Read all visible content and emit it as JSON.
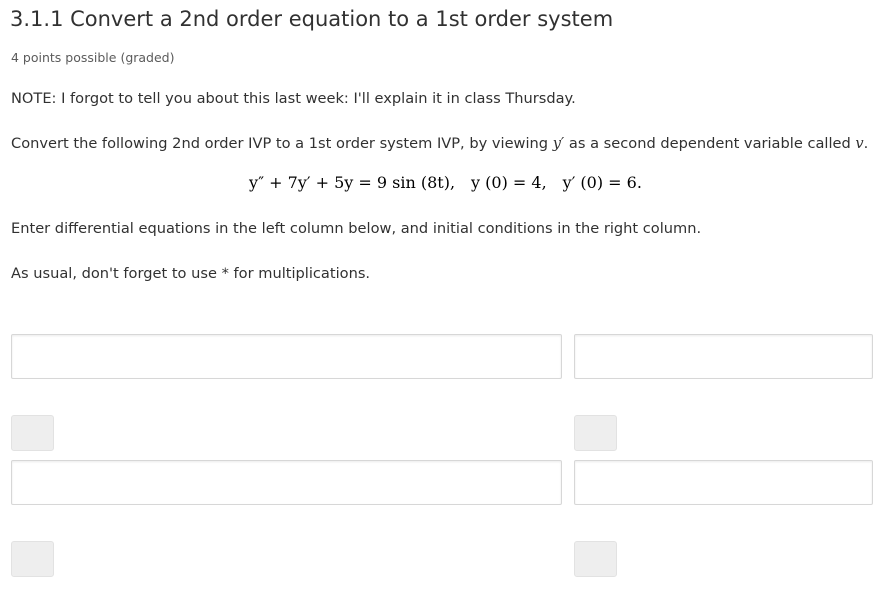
{
  "problem": {
    "title": "3.1.1 Convert a 2nd order equation to a 1st order system",
    "points": "4 points possible (graded)"
  },
  "body": {
    "note": "NOTE: I forgot to tell you about this last week: I'll explain it in class Thursday.",
    "instruction_pre": "Convert the following 2nd order IVP to a 1st order system IVP, by viewing ",
    "instruction_var1": "y′",
    "instruction_mid": " as a second dependent variable called ",
    "instruction_var2": "v",
    "instruction_end": ".",
    "equation": {
      "ode": "y″ + 7y′ + 5y = 9 sin (8t),",
      "ic1": "y (0) = 4,",
      "ic2": "y′ (0) = 6."
    },
    "enter_text": "Enter differential equations in the left column below, and initial conditions in the right column.",
    "usual_text": "As usual, don't forget to use * for multiplications."
  },
  "inputs": {
    "row1_left_value": "",
    "row1_right_value": "",
    "row2_left_value": "",
    "row2_right_value": ""
  },
  "colors": {
    "text": "#313131",
    "field_border": "#d7d7d7",
    "chip_bg": "#eeeeee"
  }
}
